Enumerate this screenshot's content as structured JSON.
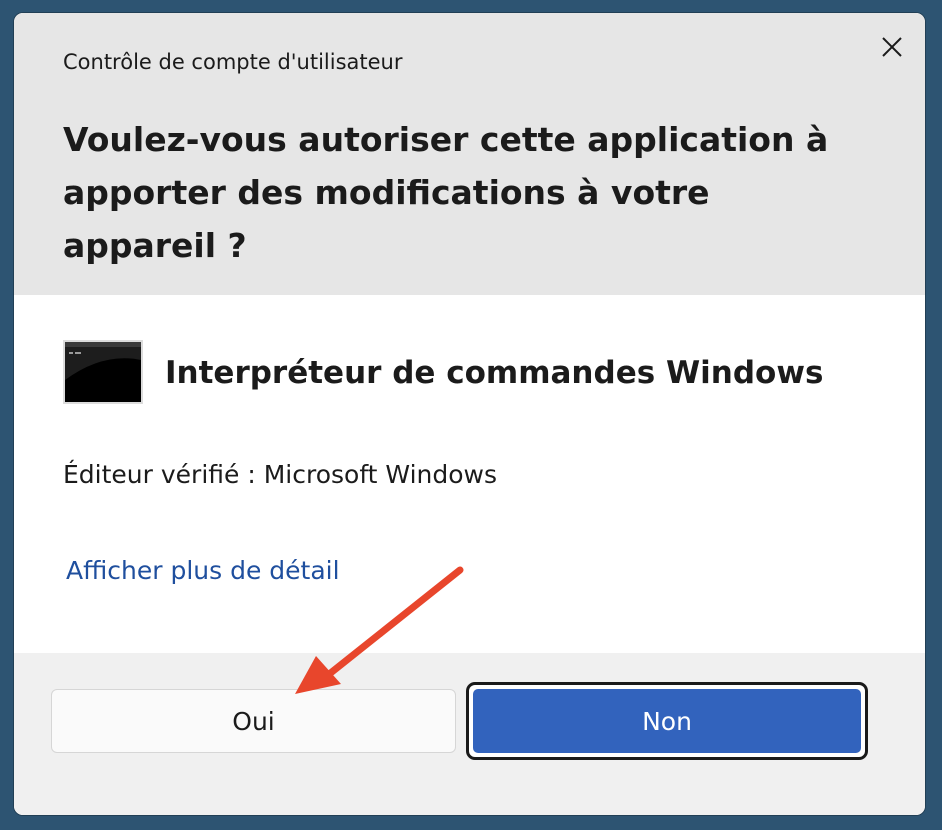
{
  "dialog": {
    "window_title": "Contrôle de compte d'utilisateur",
    "question": "Voulez-vous autoriser cette application à apporter des modifications à votre appareil ?",
    "app_name": "Interpréteur de commandes Windows",
    "publisher": "Éditeur vérifié : Microsoft Windows",
    "details_link": "Afficher plus de détail",
    "yes_label": "Oui",
    "no_label": "Non"
  },
  "icons": {
    "close": "close-icon",
    "app": "command-prompt-icon",
    "annotation": "red-arrow-icon"
  },
  "colors": {
    "primary_button": "#3263bd",
    "link": "#1f4f9e",
    "annotation_arrow": "#e8462c",
    "header_bg": "#e6e6e6",
    "footer_bg": "#f0f0f0"
  }
}
